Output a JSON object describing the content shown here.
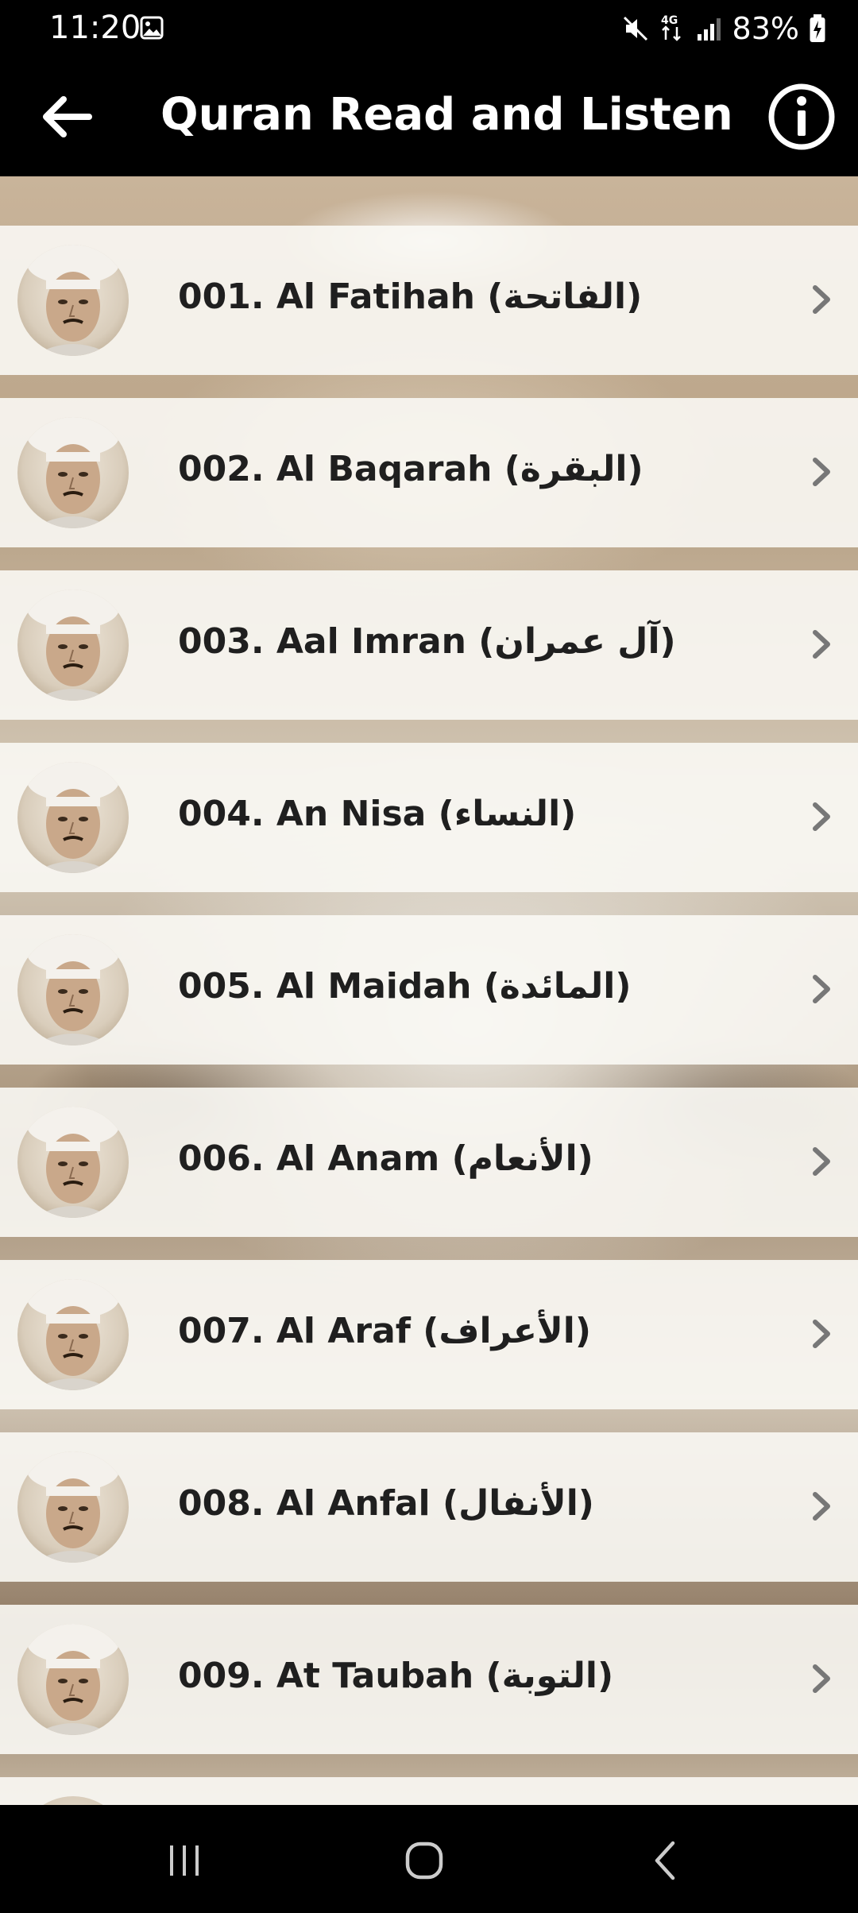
{
  "status_bar": {
    "time": "11:20",
    "battery": "83%",
    "icons": [
      "gallery-icon",
      "mute-icon",
      "4g-icon",
      "signal-icon",
      "battery-charging-icon"
    ]
  },
  "app_bar": {
    "title": "Quran Read and Listen",
    "back_icon": "back-arrow-icon",
    "info_icon": "info-icon"
  },
  "surah_list": {
    "items": [
      {
        "label": "001. Al Fatihah (الفاتحة)"
      },
      {
        "label": "002. Al Baqarah (البقرة)"
      },
      {
        "label": "003. Aal Imran (آل عمران)"
      },
      {
        "label": "004. An Nisa (النساء)"
      },
      {
        "label": "005. Al Maidah (المائدة)"
      },
      {
        "label": "006. Al Anam (الأنعام)"
      },
      {
        "label": "007. Al Araf (الأعراف)"
      },
      {
        "label": "008. Al Anfal (الأنفال)"
      },
      {
        "label": "009. At Taubah (التوبة)"
      }
    ]
  },
  "nav_bar": {
    "icons": [
      "recent-apps-icon",
      "home-icon",
      "back-icon"
    ]
  },
  "colors": {
    "bar_background": "#000000",
    "row_background": "#faf8f4",
    "text": "#1f1f1f",
    "chevron": "#777777"
  }
}
